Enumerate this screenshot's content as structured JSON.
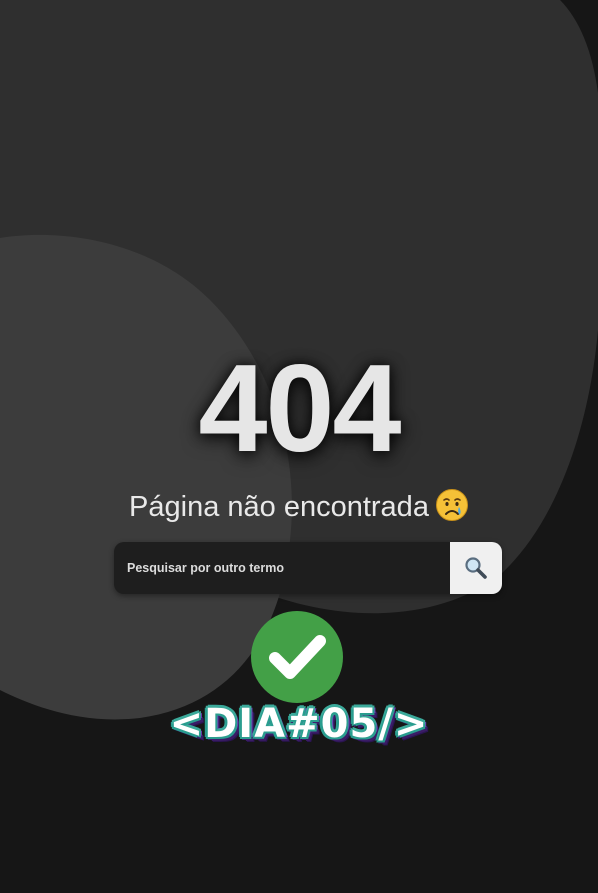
{
  "error": {
    "code": "404",
    "message": "Página não encontrada",
    "emoji_icon": "crying-face-icon"
  },
  "search": {
    "placeholder": "Pesquisar por outro termo",
    "button_icon": "magnifier-icon"
  },
  "overlay": {
    "check_icon": "check-mark-icon",
    "tag": "<DIA#05/>"
  },
  "colors": {
    "background": "#161616",
    "blob_large": "#2f2f2f",
    "blob_small": "#3c3c3c",
    "check_green": "#43a047",
    "tag_teal": "#2a9d8f",
    "tag_purple": "#3d1f6e"
  }
}
